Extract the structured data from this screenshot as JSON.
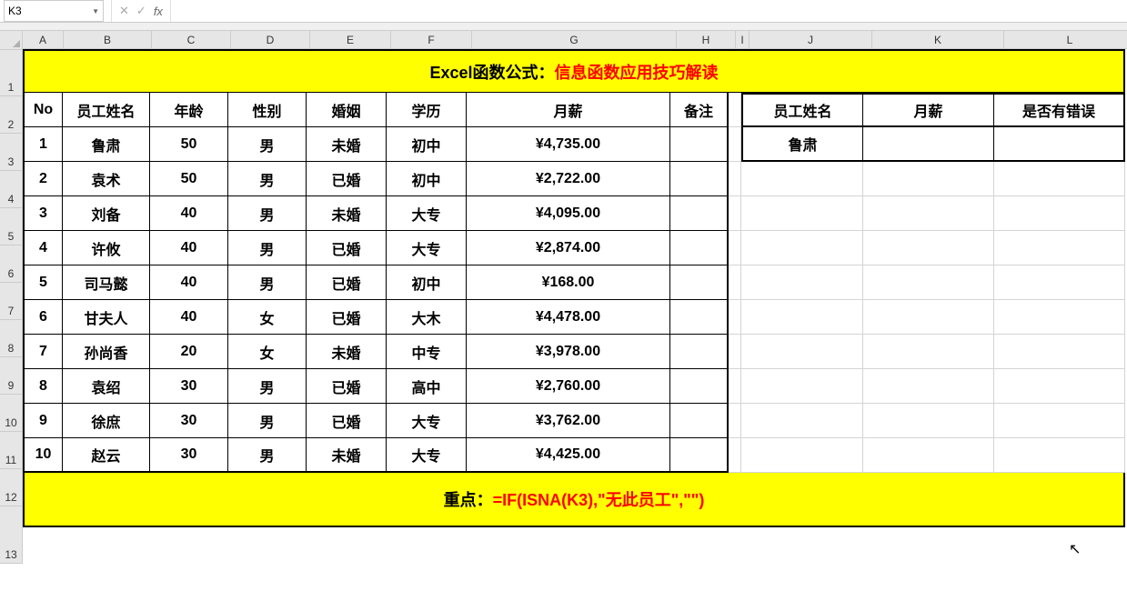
{
  "nameBox": "K3",
  "formulaBar": "",
  "columns": [
    "A",
    "B",
    "C",
    "D",
    "E",
    "F",
    "G",
    "H",
    "I",
    "J",
    "K",
    "L"
  ],
  "colWidths": {
    "A": 44,
    "B": 96,
    "C": 86,
    "D": 86,
    "E": 88,
    "F": 88,
    "G": 224,
    "H": 64,
    "I": 14,
    "J": 134,
    "K": 144,
    "L": 144
  },
  "rows": [
    "1",
    "2",
    "3",
    "4",
    "5",
    "6",
    "7",
    "8",
    "9",
    "10",
    "11",
    "12",
    "13"
  ],
  "title": {
    "prefix": "Excel函数公式：",
    "suffix": "信息函数应用技巧解读"
  },
  "headers": {
    "no": "No",
    "name": "员工姓名",
    "age": "年龄",
    "gender": "性别",
    "marriage": "婚姻",
    "education": "学历",
    "salary": "月薪",
    "note": "备注",
    "lookupName": "员工姓名",
    "lookupSalary": "月薪",
    "hasError": "是否有错误"
  },
  "data": [
    {
      "no": "1",
      "name": "鲁肃",
      "age": "50",
      "gender": "男",
      "marriage": "未婚",
      "education": "初中",
      "salary": "¥4,735.00"
    },
    {
      "no": "2",
      "name": "袁术",
      "age": "50",
      "gender": "男",
      "marriage": "已婚",
      "education": "初中",
      "salary": "¥2,722.00"
    },
    {
      "no": "3",
      "name": "刘备",
      "age": "40",
      "gender": "男",
      "marriage": "未婚",
      "education": "大专",
      "salary": "¥4,095.00"
    },
    {
      "no": "4",
      "name": "许攸",
      "age": "40",
      "gender": "男",
      "marriage": "已婚",
      "education": "大专",
      "salary": "¥2,874.00"
    },
    {
      "no": "5",
      "name": "司马懿",
      "age": "40",
      "gender": "男",
      "marriage": "已婚",
      "education": "初中",
      "salary": "¥168.00"
    },
    {
      "no": "6",
      "name": "甘夫人",
      "age": "40",
      "gender": "女",
      "marriage": "已婚",
      "education": "大木",
      "salary": "¥4,478.00"
    },
    {
      "no": "7",
      "name": "孙尚香",
      "age": "20",
      "gender": "女",
      "marriage": "未婚",
      "education": "中专",
      "salary": "¥3,978.00"
    },
    {
      "no": "8",
      "name": "袁绍",
      "age": "30",
      "gender": "男",
      "marriage": "已婚",
      "education": "高中",
      "salary": "¥2,760.00"
    },
    {
      "no": "9",
      "name": "徐庶",
      "age": "30",
      "gender": "男",
      "marriage": "已婚",
      "education": "大专",
      "salary": "¥3,762.00"
    },
    {
      "no": "10",
      "name": "赵云",
      "age": "30",
      "gender": "男",
      "marriage": "未婚",
      "education": "大专",
      "salary": "¥4,425.00"
    }
  ],
  "lookup": {
    "name": "鲁肃",
    "salary": "",
    "hasError": ""
  },
  "footer": {
    "prefix": "重点：",
    "formula": "=IF(ISNA(K3),\"无此员工\",\"\")"
  }
}
